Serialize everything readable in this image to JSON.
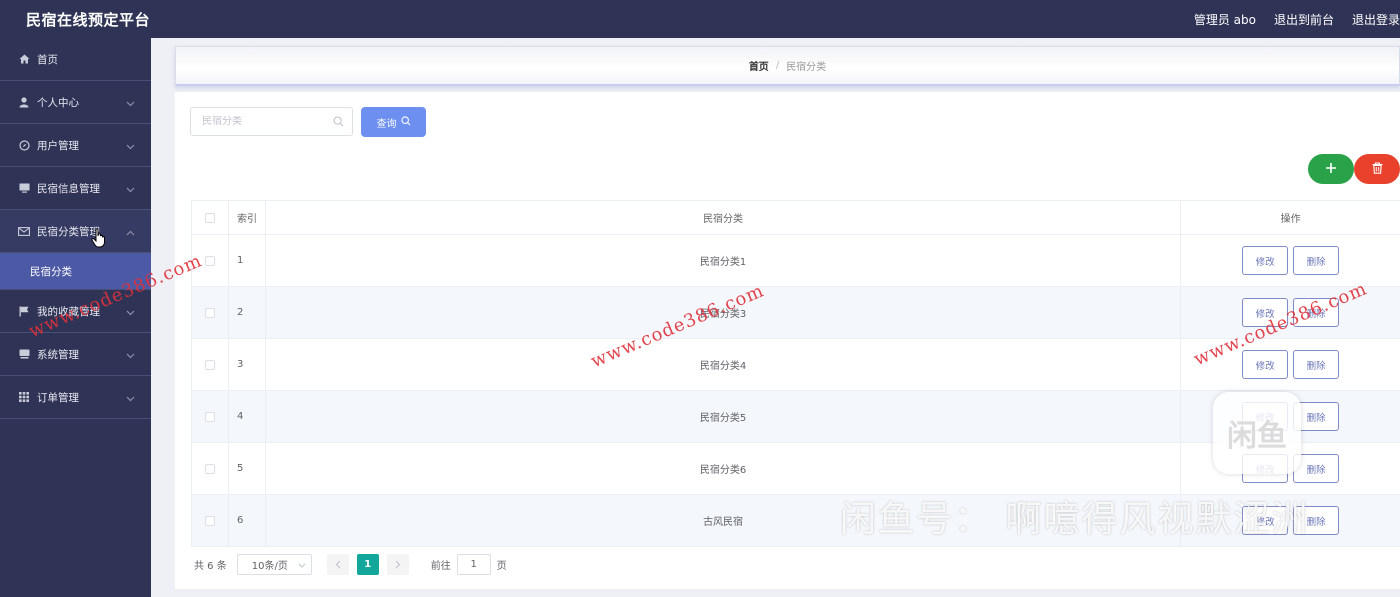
{
  "app": {
    "title": "民宿在线预定平台"
  },
  "header": {
    "links": [
      "管理员 abo",
      "退出到前台",
      "退出登录"
    ]
  },
  "sidebar": {
    "items": [
      {
        "label": "首页",
        "icon": "home-icon",
        "has_children": false
      },
      {
        "label": "个人中心",
        "icon": "user-icon",
        "has_children": true
      },
      {
        "label": "用户管理",
        "icon": "compass-icon",
        "has_children": true
      },
      {
        "label": "民宿信息管理",
        "icon": "monitor-icon",
        "has_children": true
      },
      {
        "label": "民宿分类管理",
        "icon": "mail-icon",
        "has_children": true,
        "expanded": true,
        "children": [
          "民宿分类"
        ]
      },
      {
        "label": "我的收藏管理",
        "icon": "flag-icon",
        "has_children": true
      },
      {
        "label": "系统管理",
        "icon": "device-icon",
        "has_children": true
      },
      {
        "label": "订单管理",
        "icon": "grid-icon",
        "has_children": true
      }
    ]
  },
  "breadcrumb": {
    "home": "首页",
    "separator": "/",
    "current": "民宿分类"
  },
  "search": {
    "placeholder": "民宿分类",
    "value": "",
    "button": "查询"
  },
  "table": {
    "columns": [
      "索引",
      "民宿分类",
      "操作"
    ],
    "rows": [
      {
        "index": "1",
        "name": "民宿分类1"
      },
      {
        "index": "2",
        "name": "民宿分类3"
      },
      {
        "index": "3",
        "name": "民宿分类4"
      },
      {
        "index": "4",
        "name": "民宿分类5"
      },
      {
        "index": "5",
        "name": "民宿分类6"
      },
      {
        "index": "6",
        "name": "古风民宿"
      }
    ],
    "edit_label": "修改",
    "delete_label": "删除"
  },
  "pagination": {
    "total": "共 6 条",
    "page_size": "10条/页",
    "current_page": "1",
    "goto_prefix": "前往",
    "goto_value": "1",
    "goto_suffix": "页"
  },
  "overlays": {
    "watermark": "www.code386.com",
    "xianyu_logo": "闲鱼",
    "xianyu_text": "闲鱼号：  啊噫得风视默涩洲"
  },
  "colors": {
    "sidebar_bg": "#2f3456",
    "submenu_active": "#4c5aa6",
    "query_button": "#6c8ff0",
    "add_button": "#2aa24a",
    "delete_button": "#e8412c",
    "page_active": "#13a79b",
    "watermark": "#e0303a"
  }
}
